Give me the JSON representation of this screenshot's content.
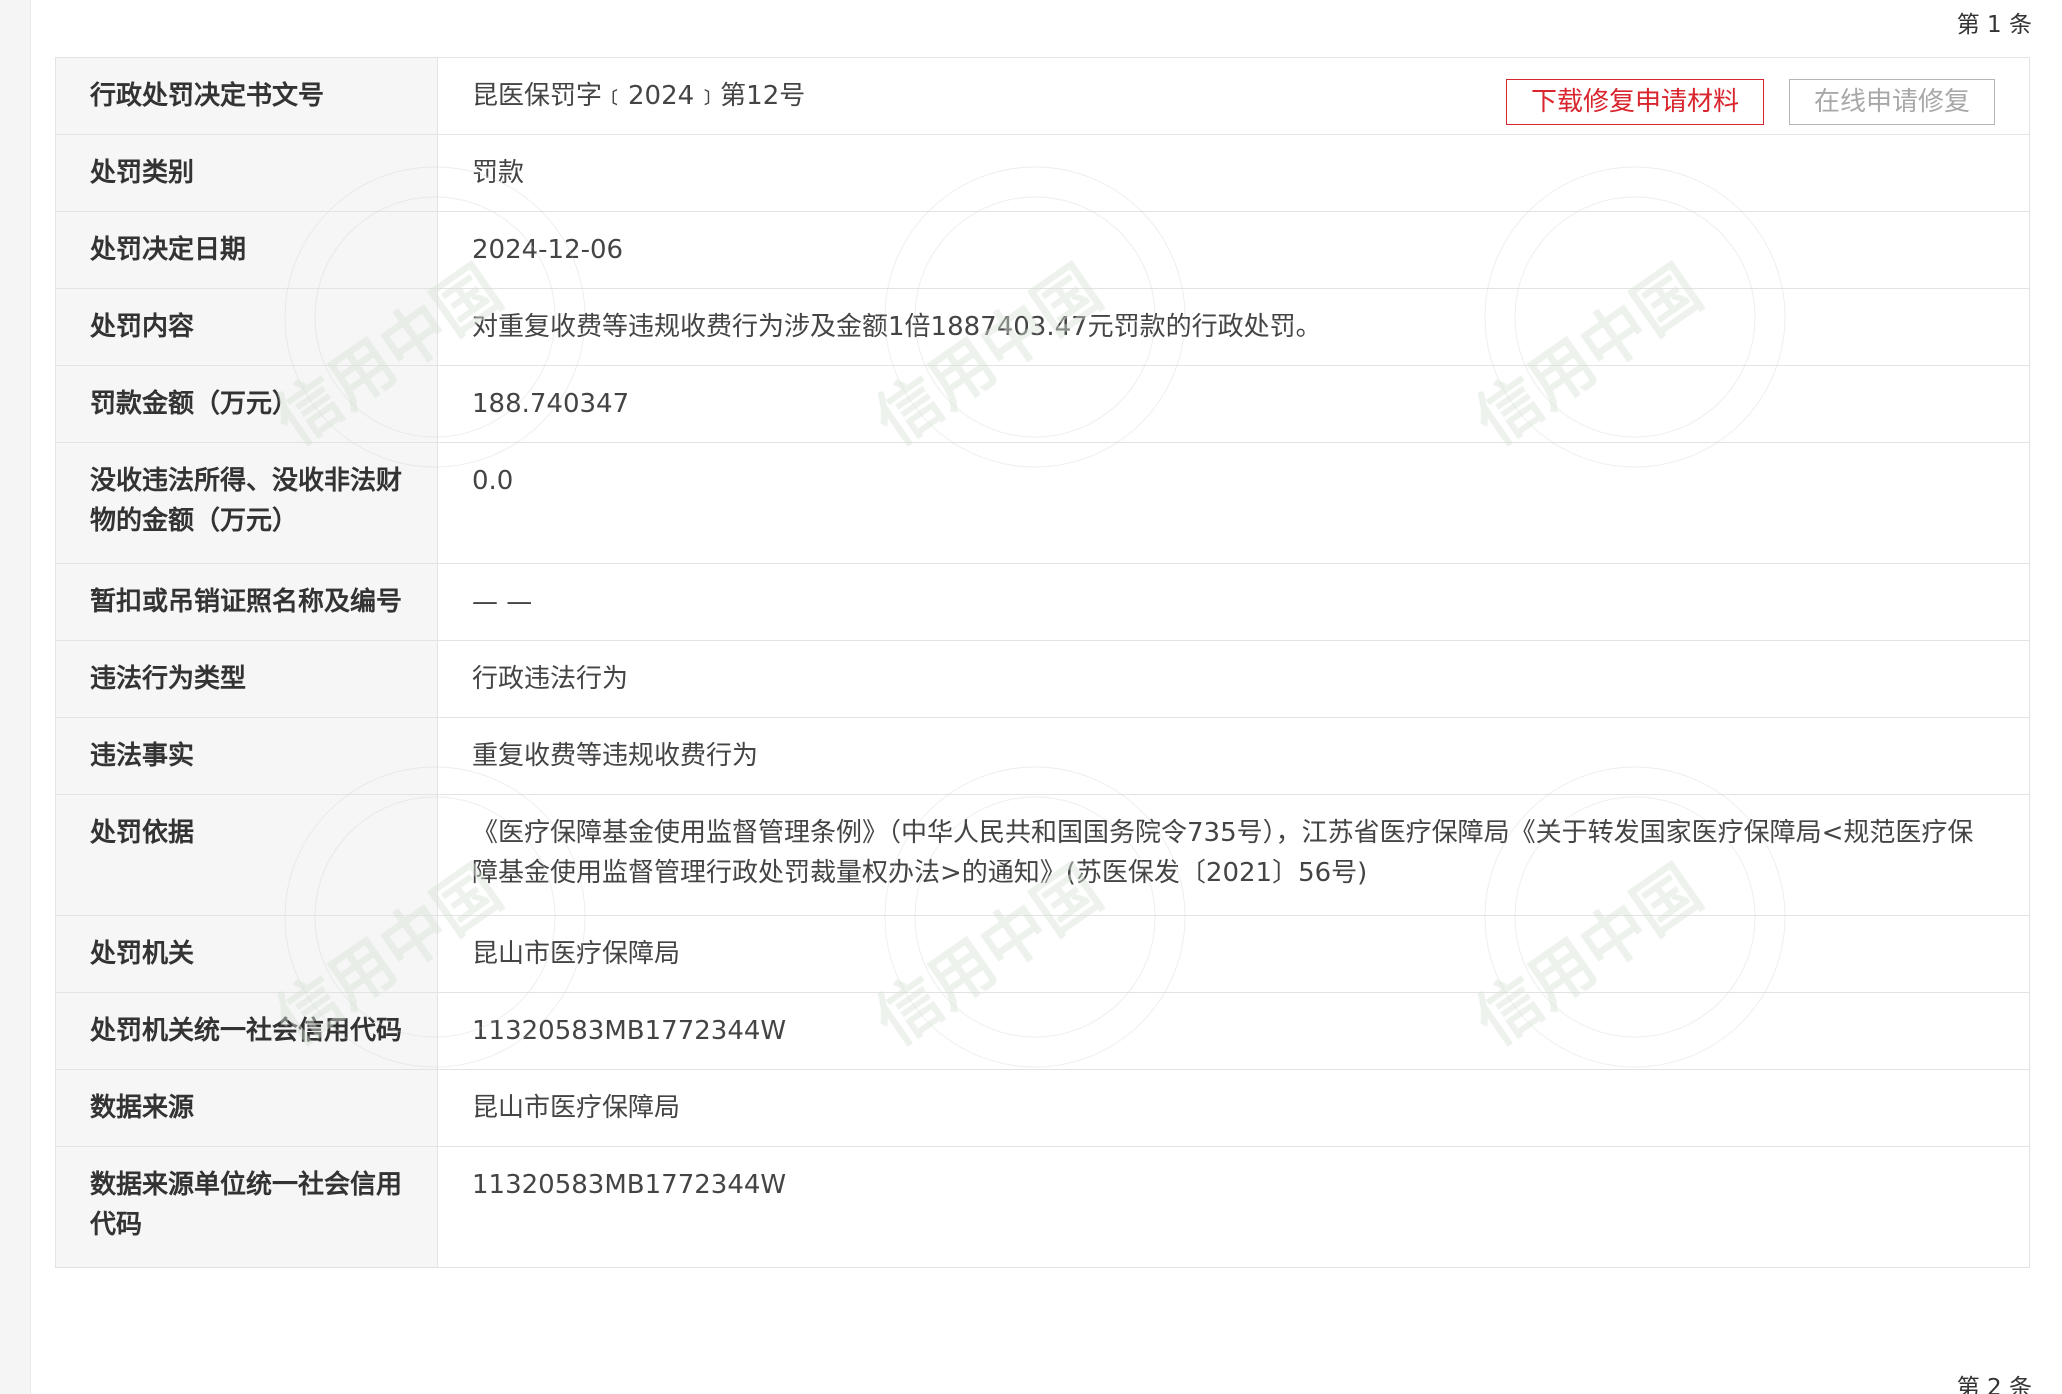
{
  "header": {
    "record_label": "第 1 条"
  },
  "footer": {
    "next_record_label": "第 2 条"
  },
  "actions": {
    "download_label": "下载修复申请材料",
    "online_repair_label": "在线申请修复"
  },
  "colors": {
    "accent": "#d9252d",
    "disabled": "#a8a8a8",
    "label_bg": "#f6f6f6",
    "border": "#e3e3e3"
  },
  "watermark": {
    "text": "信用中国"
  },
  "rows": [
    {
      "label": "行政处罚决定书文号",
      "value": "昆医保罚字﹝2024﹞第12号"
    },
    {
      "label": "处罚类别",
      "value": "罚款"
    },
    {
      "label": "处罚决定日期",
      "value": "2024-12-06"
    },
    {
      "label": "处罚内容",
      "value": "对重复收费等违规收费行为涉及金额1倍1887403.47元罚款的行政处罚。"
    },
    {
      "label": "罚款金额（万元）",
      "value": "188.740347"
    },
    {
      "label": "没收违法所得、没收非法财物的金额（万元）",
      "value": "0.0"
    },
    {
      "label": "暂扣或吊销证照名称及编号",
      "value": "— —"
    },
    {
      "label": "违法行为类型",
      "value": "行政违法行为"
    },
    {
      "label": "违法事实",
      "value": "重复收费等违规收费行为"
    },
    {
      "label": "处罚依据",
      "value": "《医疗保障基金使用监督管理条例》（中华人民共和国国务院令735号），江苏省医疗保障局《关于转发国家医疗保障局<规范医疗保障基金使用监督管理行政处罚裁量权办法>的通知》(苏医保发〔2021〕56号)"
    },
    {
      "label": "处罚机关",
      "value": "昆山市医疗保障局"
    },
    {
      "label": "处罚机关统一社会信用代码",
      "value": "11320583MB1772344W"
    },
    {
      "label": "数据来源",
      "value": "昆山市医疗保障局"
    },
    {
      "label": "数据来源单位统一社会信用代码",
      "value": "11320583MB1772344W"
    }
  ]
}
